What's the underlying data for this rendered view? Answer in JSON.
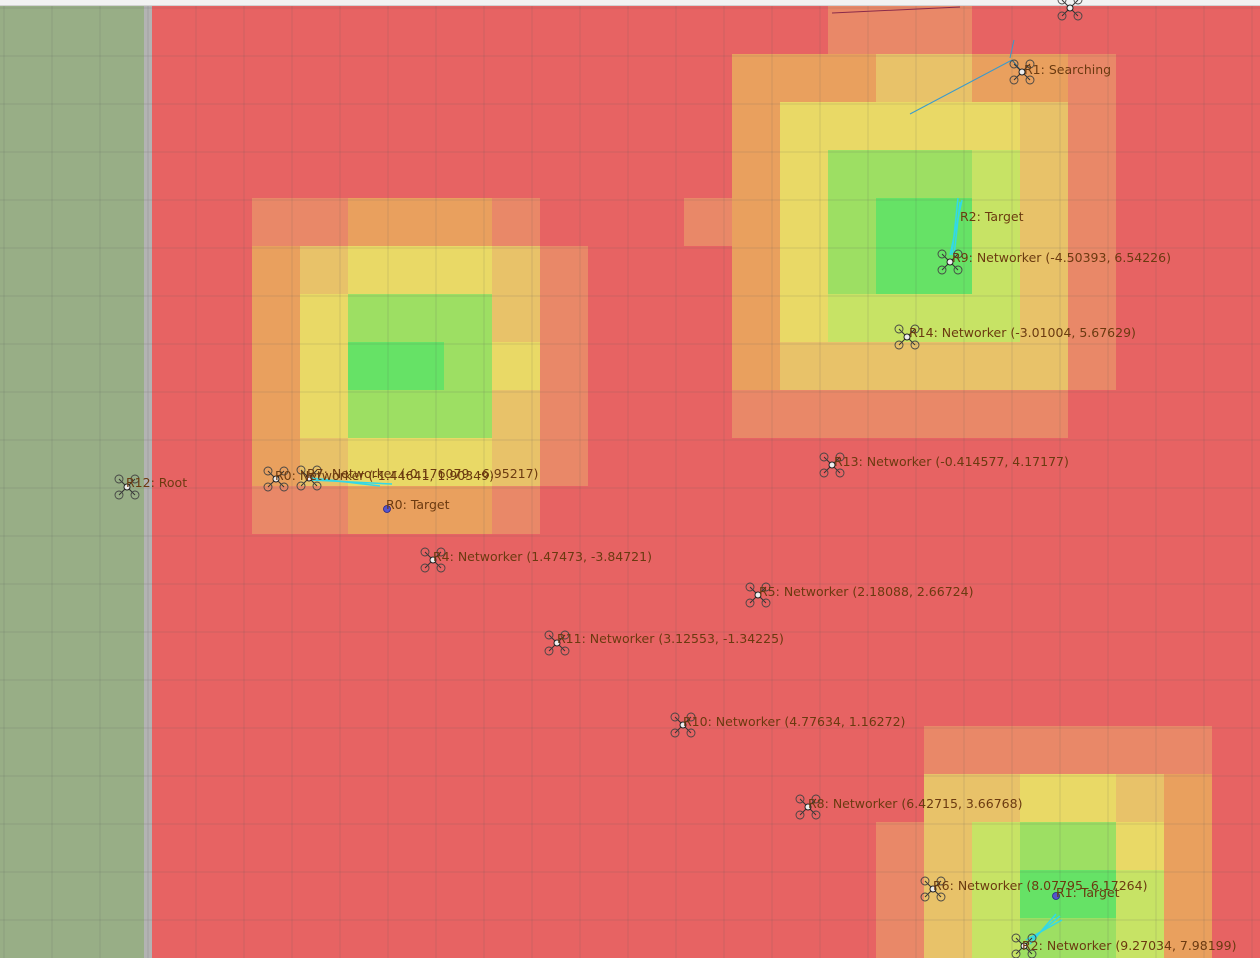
{
  "scene": {
    "colors": {
      "left_panel": "#98ae86",
      "divider": "#b3b3b3",
      "heat_low": "#e76363",
      "heat_mid_low": "#e9a05e",
      "heat_mid": "#e9d966",
      "heat_high": "#9ddf63",
      "heat_max": "#66e266",
      "comm_link": "#32d8e8",
      "target_marker": "#5555cc",
      "label_text": "#6b3a10"
    },
    "labels": [
      {
        "id": "R1-searching",
        "text": "R1: Searching"
      },
      {
        "id": "R2-target",
        "text": "R2: Target"
      },
      {
        "id": "R9-networker",
        "text": "R9: Networker (-4.50393, 6.54226)"
      },
      {
        "id": "R14-networker",
        "text": "R14: Networker (-3.01004, 5.67629)"
      },
      {
        "id": "R13-networker",
        "text": "R13: Networker (-0.414577, 4.17177)"
      },
      {
        "id": "R12-root",
        "text": "R12: Root"
      },
      {
        "id": "R0-networker",
        "text": "R0: Networker (-1.44641, 1.90349)"
      },
      {
        "id": "R7-networker",
        "text": "R7: Networker (-0.176079, -6.95217)"
      },
      {
        "id": "R0-target",
        "text": "R0: Target"
      },
      {
        "id": "R4-networker",
        "text": "R4: Networker (1.47473, -3.84721)"
      },
      {
        "id": "R5-networker",
        "text": "R5: Networker (2.18088, 2.66724)"
      },
      {
        "id": "R11-networker",
        "text": "R11: Networker (3.12553, -1.34225)"
      },
      {
        "id": "R10-networker",
        "text": "R10: Networker (4.77634, 1.16272)"
      },
      {
        "id": "R8-networker",
        "text": "R8: Networker (6.42715, 3.66768)"
      },
      {
        "id": "R6-networker",
        "text": "R6: Networker (8.07795, 6.17264)"
      },
      {
        "id": "R1-target",
        "text": "R1: Target"
      },
      {
        "id": "R2-networker",
        "text": "R2: Networker (9.27034, 7.98199)"
      }
    ]
  }
}
